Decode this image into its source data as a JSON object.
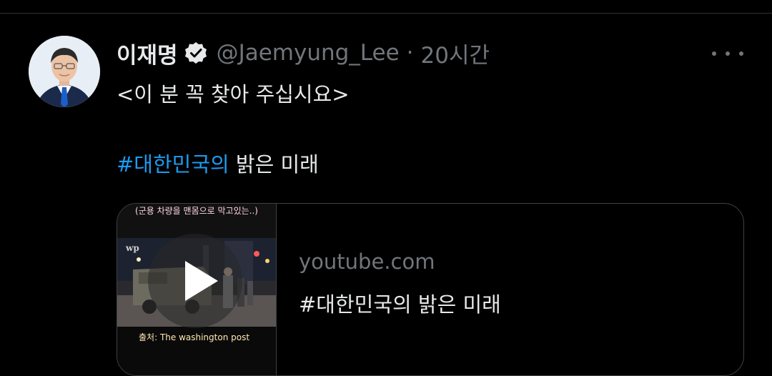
{
  "tweet": {
    "author": {
      "display_name": "이재명",
      "handle": "@Jaemyung_Lee",
      "verified_icon": "verified-badge-icon"
    },
    "separator": "·",
    "timestamp": "20시간",
    "more_icon": "more-horizontal-icon",
    "text_line1": "<이 분 꼭 찾아 주십시요>",
    "hashtag": "#대한민국의",
    "text_line2_rest": " 밝은 미래",
    "card": {
      "domain": "youtube.com",
      "title": "#대한민국의 밝은 미래",
      "thumbnail": {
        "caption_top": "(군용 차량을 맨몸으로 막고있는..)",
        "caption_bottom": "출처: The washington post",
        "logo_text": "wp",
        "play_icon": "play-icon"
      }
    }
  },
  "colors": {
    "background": "#000000",
    "text_primary": "#e7e9ea",
    "text_secondary": "#71767b",
    "accent": "#1d9bf0",
    "border": "#3e4144"
  }
}
